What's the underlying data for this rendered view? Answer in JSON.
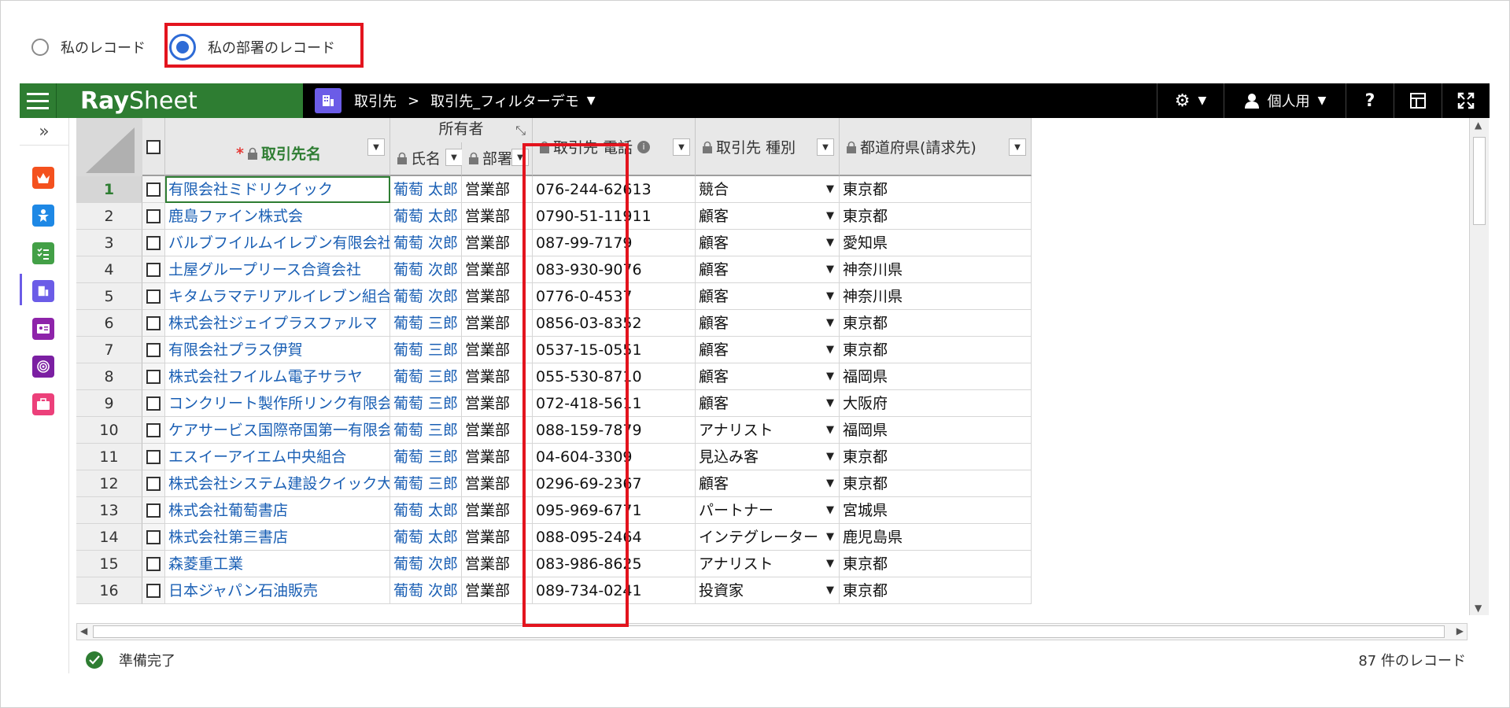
{
  "filter": {
    "option_mine": "私のレコード",
    "option_department": "私の部署のレコード",
    "selected": "department"
  },
  "header": {
    "logo_ray": "Ray",
    "logo_sheet": "Sheet",
    "breadcrumb_object": "取引先",
    "breadcrumb_separator": ">",
    "breadcrumb_view": "取引先_フィルターデモ",
    "view_mode": "個人用",
    "help_label": "?"
  },
  "sidebar": {
    "expand_label": "»",
    "icons": [
      "crown-icon",
      "person-star-icon",
      "checklist-icon",
      "building-icon",
      "contact-card-icon",
      "target-icon",
      "briefcase-icon"
    ],
    "icon_colors": [
      "#f4511e",
      "#1e88e5",
      "#43a047",
      "#6b5ce7",
      "#8e24aa",
      "#7b1fa2",
      "#ec407a"
    ]
  },
  "columns": {
    "name": "取引先名",
    "owner_group": "所有者",
    "owner_name": "氏名",
    "department": "部署",
    "phone": "取引先 電話",
    "type": "取引先 種別",
    "prefecture": "都道府県(請求先)"
  },
  "rows": [
    {
      "num": "1",
      "name": "有限会社ミドリクイック",
      "owner": "葡萄 太郎",
      "dept": "営業部",
      "phone": "076-244-62613",
      "type": "競合",
      "pref": "東京都"
    },
    {
      "num": "2",
      "name": "鹿島ファイン株式会",
      "owner": "葡萄 太郎",
      "dept": "営業部",
      "phone": "0790-51-11911",
      "type": "顧客",
      "pref": "東京都"
    },
    {
      "num": "3",
      "name": "バルブフイルムイレブン有限会社",
      "owner": "葡萄 次郎",
      "dept": "営業部",
      "phone": "087-99-7179",
      "type": "顧客",
      "pref": "愛知県"
    },
    {
      "num": "4",
      "name": "土屋グループリース合資会社",
      "owner": "葡萄 次郎",
      "dept": "営業部",
      "phone": "083-930-9076",
      "type": "顧客",
      "pref": "神奈川県"
    },
    {
      "num": "5",
      "name": "キタムラマテリアルイレブン組合",
      "owner": "葡萄 次郎",
      "dept": "営業部",
      "phone": "0776-0-4537",
      "type": "顧客",
      "pref": "神奈川県"
    },
    {
      "num": "6",
      "name": "株式会社ジェイプラスファルマ",
      "owner": "葡萄 三郎",
      "dept": "営業部",
      "phone": "0856-03-8352",
      "type": "顧客",
      "pref": "東京都"
    },
    {
      "num": "7",
      "name": "有限会社プラス伊賀",
      "owner": "葡萄 三郎",
      "dept": "営業部",
      "phone": "0537-15-0551",
      "type": "顧客",
      "pref": "東京都"
    },
    {
      "num": "8",
      "name": "株式会社フイルム電子サラヤ",
      "owner": "葡萄 三郎",
      "dept": "営業部",
      "phone": "055-530-8710",
      "type": "顧客",
      "pref": "福岡県"
    },
    {
      "num": "9",
      "name": "コンクリート製作所リンク有限会社",
      "owner": "葡萄 三郎",
      "dept": "営業部",
      "phone": "072-418-5611",
      "type": "顧客",
      "pref": "大阪府"
    },
    {
      "num": "10",
      "name": "ケアサービス国際帝国第一有限会社",
      "owner": "葡萄 三郎",
      "dept": "営業部",
      "phone": "088-159-7879",
      "type": "アナリスト",
      "pref": "福岡県"
    },
    {
      "num": "11",
      "name": "エスイーアイエム中央組合",
      "owner": "葡萄 三郎",
      "dept": "営業部",
      "phone": "04-604-3309",
      "type": "見込み客",
      "pref": "東京都"
    },
    {
      "num": "12",
      "name": "株式会社システム建設クイック大日本",
      "owner": "葡萄 三郎",
      "dept": "営業部",
      "phone": "0296-69-2367",
      "type": "顧客",
      "pref": "東京都"
    },
    {
      "num": "13",
      "name": "株式会社葡萄書店",
      "owner": "葡萄 太郎",
      "dept": "営業部",
      "phone": "095-969-6771",
      "type": "パートナー",
      "pref": "宮城県"
    },
    {
      "num": "14",
      "name": "株式会社第三書店",
      "owner": "葡萄 太郎",
      "dept": "営業部",
      "phone": "088-095-2464",
      "type": "インテグレーター",
      "pref": "鹿児島県"
    },
    {
      "num": "15",
      "name": "森菱重工業",
      "owner": "葡萄 次郎",
      "dept": "営業部",
      "phone": "083-986-8625",
      "type": "アナリスト",
      "pref": "東京都"
    },
    {
      "num": "16",
      "name": "日本ジャパン石油販売",
      "owner": "葡萄 次郎",
      "dept": "営業部",
      "phone": "089-734-0241",
      "type": "投資家",
      "pref": "東京都"
    }
  ],
  "status": {
    "message": "準備完了",
    "count": "87 件のレコード"
  }
}
